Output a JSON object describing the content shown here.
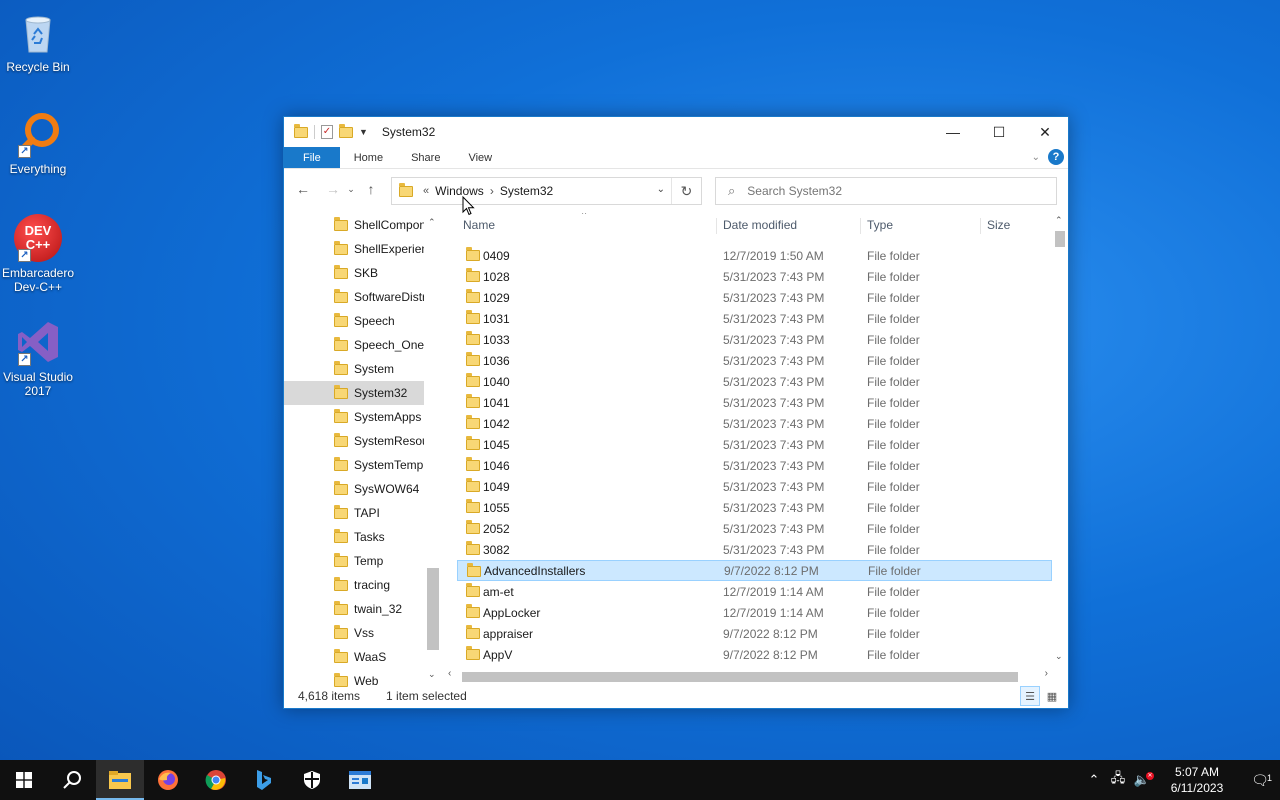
{
  "desktop": {
    "icons": [
      {
        "label": "Recycle Bin",
        "icon": "recycle-bin-icon"
      },
      {
        "label": "Everything",
        "icon": "everything-search-icon"
      },
      {
        "label": "Embarcadero Dev-C++",
        "icon": "devcpp-icon",
        "badge": "DEV C++"
      },
      {
        "label": "Visual Studio 2017",
        "icon": "visual-studio-icon"
      }
    ]
  },
  "window": {
    "title": "System32",
    "controls": {
      "minimize": "—",
      "maximize": "☐",
      "close": "✕"
    },
    "ribbon_tabs": [
      "File",
      "Home",
      "Share",
      "View"
    ],
    "help": "?",
    "address": {
      "crumbs": [
        "«",
        "Windows",
        "›",
        "System32"
      ]
    },
    "search": {
      "placeholder": "Search System32"
    },
    "nav_items": [
      "ShellComponents",
      "ShellExperiences",
      "SKB",
      "SoftwareDistribution",
      "Speech",
      "Speech_OneCore",
      "System",
      "System32",
      "SystemApps",
      "SystemResources",
      "SystemTemp",
      "SysWOW64",
      "TAPI",
      "Tasks",
      "Temp",
      "tracing",
      "twain_32",
      "Vss",
      "WaaS",
      "Web"
    ],
    "nav_selected": "System32",
    "columns": {
      "name": "Name",
      "date": "Date modified",
      "type": "Type",
      "size": "Size"
    },
    "files": [
      {
        "name": "0409",
        "date": "12/7/2019 1:50 AM",
        "type": "File folder"
      },
      {
        "name": "1028",
        "date": "5/31/2023 7:43 PM",
        "type": "File folder"
      },
      {
        "name": "1029",
        "date": "5/31/2023 7:43 PM",
        "type": "File folder"
      },
      {
        "name": "1031",
        "date": "5/31/2023 7:43 PM",
        "type": "File folder"
      },
      {
        "name": "1033",
        "date": "5/31/2023 7:43 PM",
        "type": "File folder"
      },
      {
        "name": "1036",
        "date": "5/31/2023 7:43 PM",
        "type": "File folder"
      },
      {
        "name": "1040",
        "date": "5/31/2023 7:43 PM",
        "type": "File folder"
      },
      {
        "name": "1041",
        "date": "5/31/2023 7:43 PM",
        "type": "File folder"
      },
      {
        "name": "1042",
        "date": "5/31/2023 7:43 PM",
        "type": "File folder"
      },
      {
        "name": "1045",
        "date": "5/31/2023 7:43 PM",
        "type": "File folder"
      },
      {
        "name": "1046",
        "date": "5/31/2023 7:43 PM",
        "type": "File folder"
      },
      {
        "name": "1049",
        "date": "5/31/2023 7:43 PM",
        "type": "File folder"
      },
      {
        "name": "1055",
        "date": "5/31/2023 7:43 PM",
        "type": "File folder"
      },
      {
        "name": "2052",
        "date": "5/31/2023 7:43 PM",
        "type": "File folder"
      },
      {
        "name": "3082",
        "date": "5/31/2023 7:43 PM",
        "type": "File folder"
      },
      {
        "name": "AdvancedInstallers",
        "date": "9/7/2022 8:12 PM",
        "type": "File folder",
        "selected": true
      },
      {
        "name": "am-et",
        "date": "12/7/2019 1:14 AM",
        "type": "File folder"
      },
      {
        "name": "AppLocker",
        "date": "12/7/2019 1:14 AM",
        "type": "File folder"
      },
      {
        "name": "appraiser",
        "date": "9/7/2022 8:12 PM",
        "type": "File folder"
      },
      {
        "name": "AppV",
        "date": "9/7/2022 8:12 PM",
        "type": "File folder"
      }
    ],
    "status": {
      "count": "4,618 items",
      "selection": "1 item selected"
    }
  },
  "taskbar": {
    "apps": [
      {
        "name": "start-button",
        "icon": "windows-logo-icon"
      },
      {
        "name": "search-button",
        "icon": "search-icon"
      },
      {
        "name": "file-explorer",
        "icon": "folder-icon",
        "active": true
      },
      {
        "name": "firefox",
        "icon": "firefox-icon"
      },
      {
        "name": "chrome",
        "icon": "chrome-icon"
      },
      {
        "name": "bing-copilot",
        "icon": "bing-icon"
      },
      {
        "name": "windows-security",
        "icon": "shield-icon"
      },
      {
        "name": "control-panel",
        "icon": "control-panel-icon"
      }
    ],
    "clock": {
      "time": "5:07 AM",
      "date": "6/11/2023"
    },
    "notification_count": "1"
  },
  "colors": {
    "accent": "#1979ca",
    "selection": "#cce8ff",
    "folder": "#f8d775"
  }
}
